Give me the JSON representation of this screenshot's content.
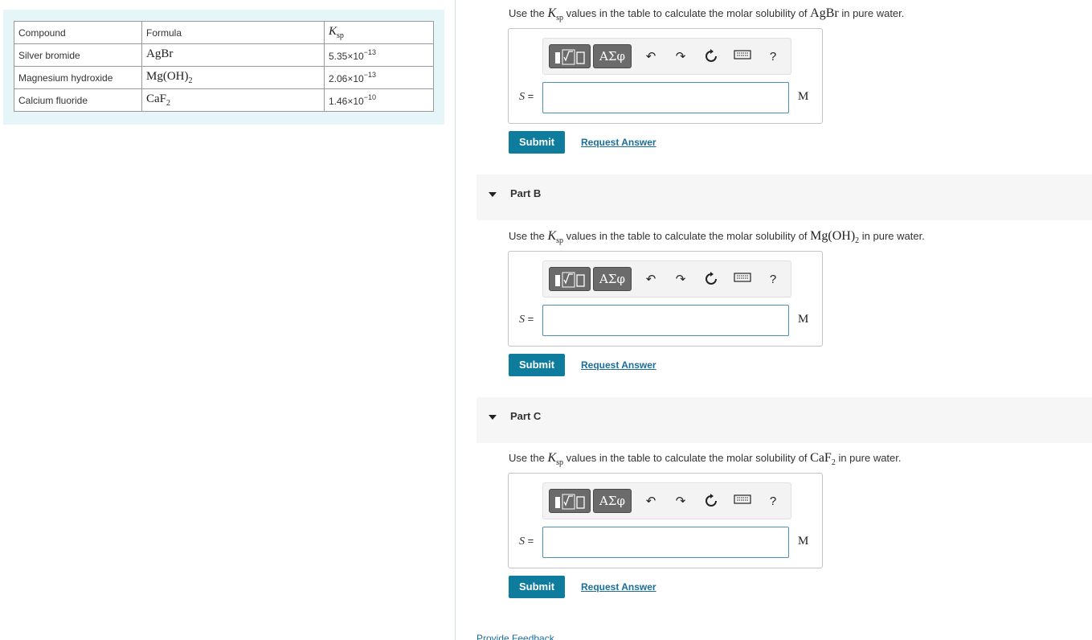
{
  "table": {
    "headers": [
      "Compound",
      "Formula",
      "Ksp"
    ],
    "rows": [
      {
        "compound": "Silver bromide",
        "formula_base": "AgBr",
        "formula_sub": "",
        "ksp_mantissa": "5.35×10",
        "ksp_exp": "−13"
      },
      {
        "compound": "Magnesium hydroxide",
        "formula_base": "Mg(OH)",
        "formula_sub": "2",
        "ksp_mantissa": "2.06×10",
        "ksp_exp": "−13"
      },
      {
        "compound": "Calcium fluoride",
        "formula_base": "CaF",
        "formula_sub": "2",
        "ksp_mantissa": "1.46×10",
        "ksp_exp": "−10"
      }
    ]
  },
  "ksp_symbol": {
    "main": "K",
    "sub": "sp"
  },
  "common": {
    "question_prefix": "Use the",
    "question_middle": "values in the table to calculate the molar solubility of",
    "question_suffix": "in pure water.",
    "s_label": "S",
    "equals": "=",
    "unit": "M",
    "submit": "Submit",
    "request": "Request Answer",
    "greek": "ΑΣφ",
    "help": "?"
  },
  "parts": [
    {
      "title": "",
      "compound_base": "AgBr",
      "compound_sub": ""
    },
    {
      "title": "Part B",
      "compound_base": "Mg(OH)",
      "compound_sub": "2"
    },
    {
      "title": "Part C",
      "compound_base": "CaF",
      "compound_sub": "2"
    }
  ],
  "feedback": "Provide Feedback"
}
